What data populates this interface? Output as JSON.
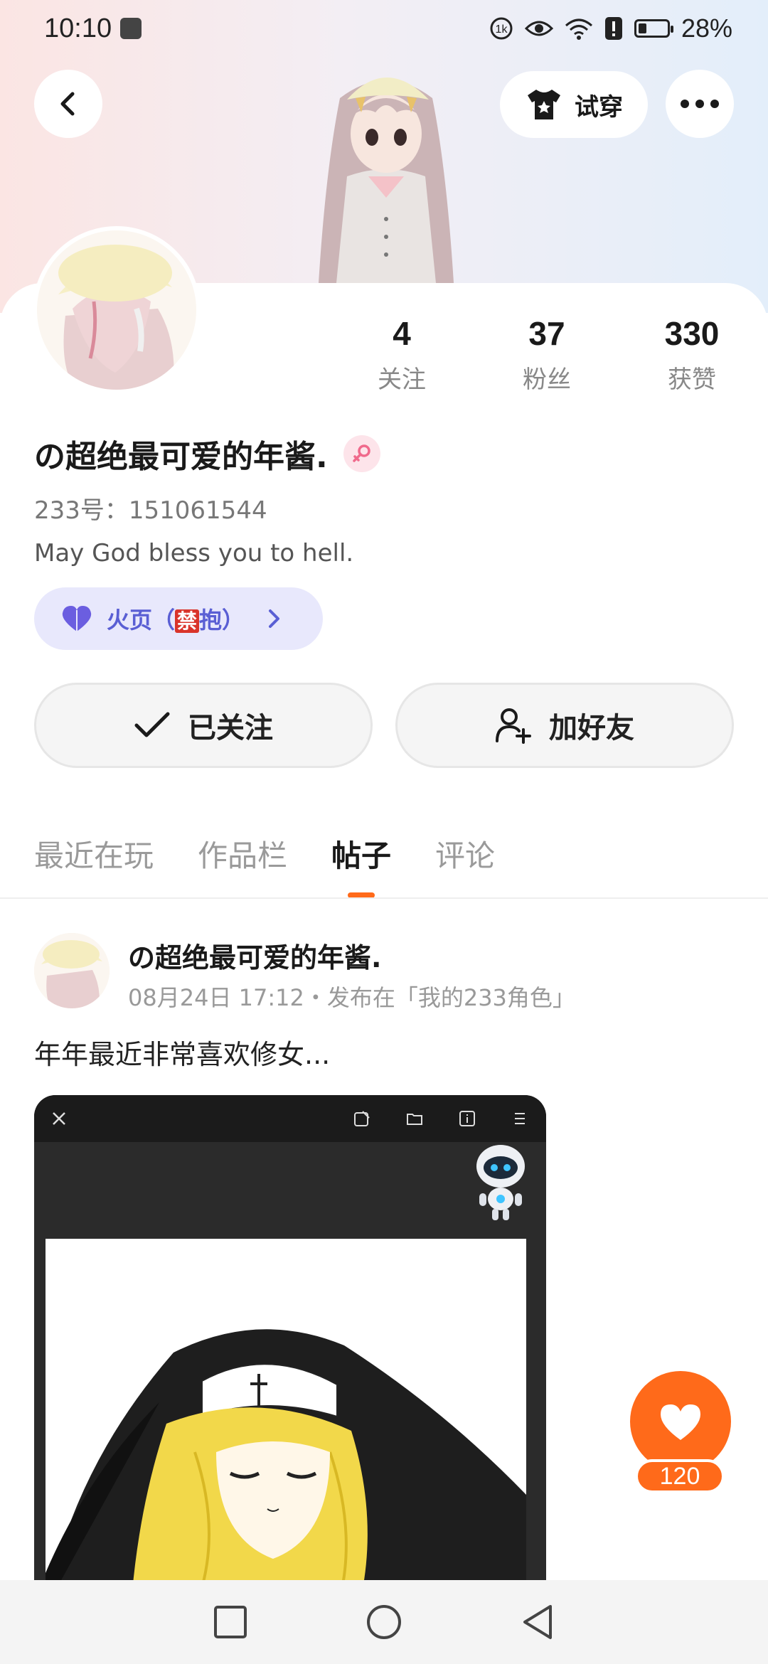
{
  "status_bar": {
    "time": "10:10",
    "battery": "28%",
    "battery_level": 0.28
  },
  "header": {
    "tryon_label": "试穿"
  },
  "profile": {
    "stats": [
      {
        "value": "4",
        "label": "关注"
      },
      {
        "value": "37",
        "label": "粉丝"
      },
      {
        "value": "330",
        "label": "获赞"
      }
    ],
    "username": "の超绝最可爱的年酱.",
    "uid": "233号：151061544",
    "bio": "May God bless you to hell.",
    "tag": {
      "prefix": "火页（",
      "ban_char": "禁",
      "suffix": "抱）"
    },
    "follow_button": "已关注",
    "add_friend_button": "加好友"
  },
  "tabs": [
    {
      "label": "最近在玩",
      "active": false
    },
    {
      "label": "作品栏",
      "active": false
    },
    {
      "label": "帖子",
      "active": true
    },
    {
      "label": "评论",
      "active": false
    }
  ],
  "post": {
    "author": "の超绝最可爱的年酱.",
    "meta": "08月24日 17:12・发布在「我的233角色」",
    "text": "年年最近非常喜欢修女..."
  },
  "like": {
    "count": "120"
  },
  "colors": {
    "accent": "#ff6a1a",
    "tag_bg": "#e8e8fc",
    "tag_text": "#5a5fd4"
  }
}
